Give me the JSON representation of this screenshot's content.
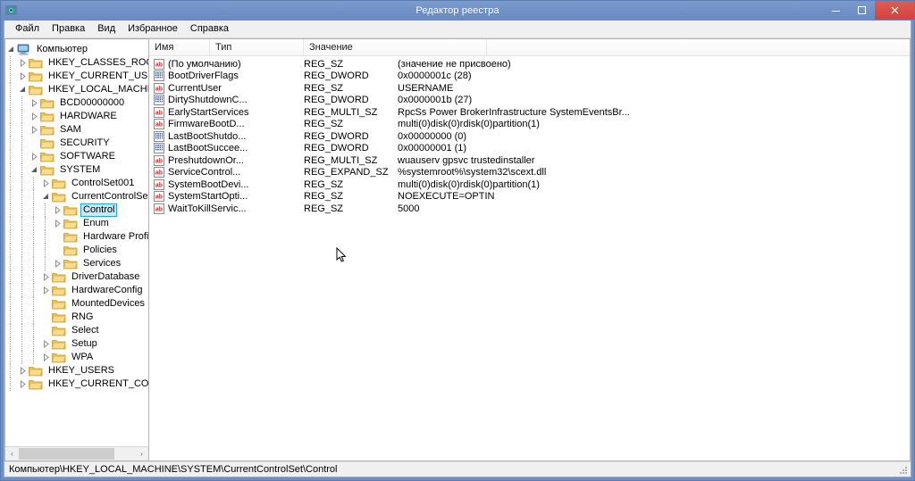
{
  "window": {
    "title": "Редактор реестра",
    "icon": "registry-editor-icon",
    "minimize_label": "—",
    "maximize_label": "❐",
    "close_label": "✕"
  },
  "menu": {
    "items": [
      {
        "label": "Файл",
        "name": "menu-file"
      },
      {
        "label": "Правка",
        "name": "menu-edit"
      },
      {
        "label": "Вид",
        "name": "menu-view"
      },
      {
        "label": "Избранное",
        "name": "menu-favorites"
      },
      {
        "label": "Справка",
        "name": "menu-help"
      }
    ]
  },
  "tree": {
    "items": [
      {
        "label": "Компьютер",
        "level": 0,
        "expander": "open",
        "icon": "computer-icon",
        "selected": false
      },
      {
        "label": "HKEY_CLASSES_ROOT",
        "level": 1,
        "expander": "closed",
        "icon": "folder-icon",
        "selected": false
      },
      {
        "label": "HKEY_CURRENT_USER",
        "level": 1,
        "expander": "closed",
        "icon": "folder-icon",
        "selected": false
      },
      {
        "label": "HKEY_LOCAL_MACHINE",
        "level": 1,
        "expander": "open",
        "icon": "folder-icon",
        "selected": false
      },
      {
        "label": "BCD00000000",
        "level": 2,
        "expander": "closed",
        "icon": "folder-icon",
        "selected": false
      },
      {
        "label": "HARDWARE",
        "level": 2,
        "expander": "closed",
        "icon": "folder-icon",
        "selected": false
      },
      {
        "label": "SAM",
        "level": 2,
        "expander": "closed",
        "icon": "folder-icon",
        "selected": false
      },
      {
        "label": "SECURITY",
        "level": 2,
        "expander": "none",
        "icon": "folder-icon",
        "selected": false
      },
      {
        "label": "SOFTWARE",
        "level": 2,
        "expander": "closed",
        "icon": "folder-icon",
        "selected": false
      },
      {
        "label": "SYSTEM",
        "level": 2,
        "expander": "open",
        "icon": "folder-icon",
        "selected": false
      },
      {
        "label": "ControlSet001",
        "level": 3,
        "expander": "closed",
        "icon": "folder-icon",
        "selected": false
      },
      {
        "label": "CurrentControlSet",
        "level": 3,
        "expander": "open",
        "icon": "folder-icon",
        "selected": false
      },
      {
        "label": "Control",
        "level": 4,
        "expander": "closed",
        "icon": "folder-icon",
        "selected": true
      },
      {
        "label": "Enum",
        "level": 4,
        "expander": "closed",
        "icon": "folder-icon",
        "selected": false
      },
      {
        "label": "Hardware Profiles",
        "level": 4,
        "expander": "none",
        "icon": "folder-icon",
        "selected": false
      },
      {
        "label": "Policies",
        "level": 4,
        "expander": "none",
        "icon": "folder-icon",
        "selected": false
      },
      {
        "label": "Services",
        "level": 4,
        "expander": "closed",
        "icon": "folder-icon",
        "selected": false
      },
      {
        "label": "DriverDatabase",
        "level": 3,
        "expander": "closed",
        "icon": "folder-icon",
        "selected": false
      },
      {
        "label": "HardwareConfig",
        "level": 3,
        "expander": "closed",
        "icon": "folder-icon",
        "selected": false
      },
      {
        "label": "MountedDevices",
        "level": 3,
        "expander": "none",
        "icon": "folder-icon",
        "selected": false
      },
      {
        "label": "RNG",
        "level": 3,
        "expander": "none",
        "icon": "folder-icon",
        "selected": false
      },
      {
        "label": "Select",
        "level": 3,
        "expander": "none",
        "icon": "folder-icon",
        "selected": false
      },
      {
        "label": "Setup",
        "level": 3,
        "expander": "closed",
        "icon": "folder-icon",
        "selected": false
      },
      {
        "label": "WPA",
        "level": 3,
        "expander": "closed",
        "icon": "folder-icon",
        "selected": false
      },
      {
        "label": "HKEY_USERS",
        "level": 1,
        "expander": "closed",
        "icon": "folder-icon",
        "selected": false
      },
      {
        "label": "HKEY_CURRENT_CONFIG",
        "level": 1,
        "expander": "closed",
        "icon": "folder-icon",
        "selected": false
      }
    ],
    "hscroll": {
      "left_arrow": "‹",
      "right_arrow": "›"
    }
  },
  "list": {
    "columns": [
      {
        "label": "Имя",
        "name": "column-name"
      },
      {
        "label": "Тип",
        "name": "column-type"
      },
      {
        "label": "Значение",
        "name": "column-value"
      }
    ],
    "rows": [
      {
        "name": "(По умолчанию)",
        "type": "REG_SZ",
        "value": "(значение не присвоено)",
        "icon": "string-value-icon"
      },
      {
        "name": "BootDriverFlags",
        "type": "REG_DWORD",
        "value": "0x0000001c (28)",
        "icon": "binary-value-icon"
      },
      {
        "name": "CurrentUser",
        "type": "REG_SZ",
        "value": "USERNAME",
        "icon": "string-value-icon"
      },
      {
        "name": "DirtyShutdownC...",
        "type": "REG_DWORD",
        "value": "0x0000001b (27)",
        "icon": "binary-value-icon"
      },
      {
        "name": "EarlyStartServices",
        "type": "REG_MULTI_SZ",
        "value": "RpcSs Power BrokerInfrastructure SystemEventsBr...",
        "icon": "string-value-icon"
      },
      {
        "name": "FirmwareBootD...",
        "type": "REG_SZ",
        "value": "multi(0)disk(0)rdisk(0)partition(1)",
        "icon": "string-value-icon"
      },
      {
        "name": "LastBootShutdo...",
        "type": "REG_DWORD",
        "value": "0x00000000 (0)",
        "icon": "binary-value-icon"
      },
      {
        "name": "LastBootSuccee...",
        "type": "REG_DWORD",
        "value": "0x00000001 (1)",
        "icon": "binary-value-icon"
      },
      {
        "name": "PreshutdownOr...",
        "type": "REG_MULTI_SZ",
        "value": "wuauserv gpsvc trustedinstaller",
        "icon": "string-value-icon"
      },
      {
        "name": "ServiceControl...",
        "type": "REG_EXPAND_SZ",
        "value": "%systemroot%\\system32\\scext.dll",
        "icon": "string-value-icon"
      },
      {
        "name": "SystemBootDevi...",
        "type": "REG_SZ",
        "value": "multi(0)disk(0)rdisk(0)partition(1)",
        "icon": "string-value-icon"
      },
      {
        "name": "SystemStartOpti...",
        "type": "REG_SZ",
        "value": " NOEXECUTE=OPTIN",
        "icon": "string-value-icon"
      },
      {
        "name": "WaitToKillServic...",
        "type": "REG_SZ",
        "value": "5000",
        "icon": "string-value-icon"
      }
    ]
  },
  "statusbar": {
    "path": "Компьютер\\HKEY_LOCAL_MACHINE\\SYSTEM\\CurrentControlSet\\Control"
  },
  "colors": {
    "titlebar": "#6f8fc4",
    "close_button": "#d9534f",
    "selection": "#cbe8f6",
    "selection_border": "#26a0da",
    "folder": "#f3c969"
  }
}
